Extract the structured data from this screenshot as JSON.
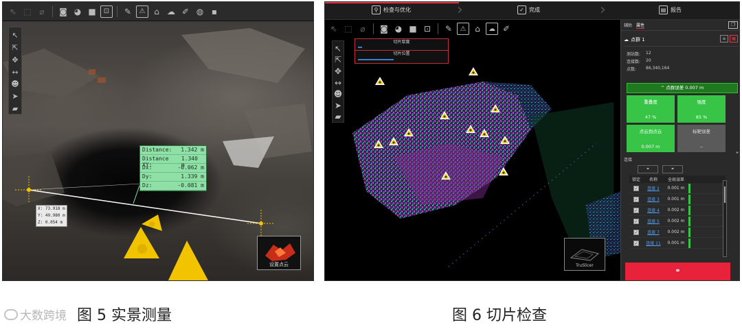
{
  "figure_left": {
    "caption": "图 5  实景测量",
    "toolbar_icons": [
      "pointer-icon",
      "select-icon",
      "lasso-icon",
      "camera-icon",
      "palette-icon",
      "square-icon",
      "fit-icon",
      "pen-icon",
      "warning-icon",
      "tag-icon",
      "cloud-icon",
      "brush-icon",
      "globe-icon",
      "color-icon"
    ],
    "side_tools": [
      "cursor-icon",
      "multi-select-icon",
      "move-icon",
      "measure-icon",
      "person-icon",
      "navigate-icon",
      "layers-icon"
    ],
    "measurement": [
      {
        "label": "Distance:",
        "value": "1.342 m"
      },
      {
        "label": "Distance XY:",
        "value": "1.340 m"
      },
      {
        "label": "Dx:",
        "value": "-0.062 m"
      },
      {
        "label": "Dy:",
        "value": "1.339 m"
      },
      {
        "label": "Dz:",
        "value": "-0.081 m"
      }
    ],
    "coords": [
      {
        "label": "X:",
        "value": "73.918 m"
      },
      {
        "label": "Y:",
        "value": "49.980 m"
      },
      {
        "label": "Z:",
        "value": "0.054 m"
      }
    ],
    "thumbnail_label": "设置点云"
  },
  "figure_right": {
    "caption": "图 6  切片检查",
    "steps": [
      {
        "label": "检查与优化",
        "icon": "search-icon"
      },
      {
        "label": "完成",
        "icon": "check-icon"
      },
      {
        "label": "报告",
        "icon": "report-icon"
      }
    ],
    "slice_controls": [
      "切片厚度",
      "切片位置"
    ],
    "slice_thickness_level": 0.05,
    "slice_position_level": 0.4,
    "thumbnail_label": "TruSlicer",
    "side_tabs": [
      "辅助",
      "属性"
    ],
    "cloud_name": "点群 1",
    "stats": [
      {
        "k": "测站数:",
        "v": "12"
      },
      {
        "k": "连接数:",
        "v": "20"
      },
      {
        "k": "点数:",
        "v": "86,340,164"
      }
    ],
    "quality_button": "^ 点群误差 0.007 m",
    "quality_cells": [
      {
        "title": "重叠度",
        "value": "47 %",
        "style": "green"
      },
      {
        "title": "强度",
        "value": "85 %",
        "style": "green"
      },
      {
        "title": "点云到点云",
        "value": "0.007 m",
        "style": "green"
      },
      {
        "title": "标靶误差",
        "value": "--",
        "style": "gray"
      }
    ],
    "connection_title": "连接",
    "table_headers": [
      "锁定",
      "名称",
      "全局误差"
    ],
    "table_rows": [
      {
        "name": "连接 2",
        "error": "0.001 m"
      },
      {
        "name": "连接 3",
        "error": "0.001 m"
      },
      {
        "name": "连接 4",
        "error": "0.002 m"
      },
      {
        "name": "连接 5",
        "error": "0.002 m"
      },
      {
        "name": "连接 7",
        "error": "0.002 m"
      },
      {
        "name": "连接 11",
        "error": "0.001 m"
      }
    ]
  },
  "watermark": "大数跨境",
  "colors": {
    "accent_red": "#e8223a",
    "success_green": "#37c447",
    "measure_green": "#8fe0a7",
    "marker_yellow": "#f2c400"
  }
}
